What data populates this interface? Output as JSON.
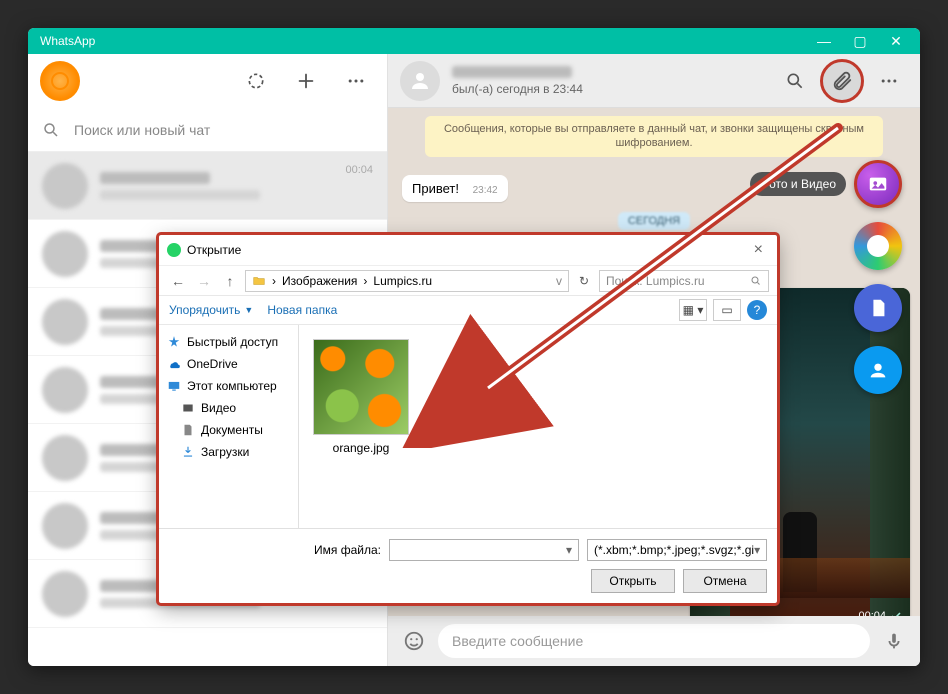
{
  "window": {
    "app_title": "WhatsApp"
  },
  "sidebar": {
    "search_placeholder": "Поиск или новый чат",
    "chats": [
      {
        "time": "00:04"
      },
      {
        "time": ""
      },
      {
        "time": ""
      },
      {
        "time": ""
      },
      {
        "time": ""
      },
      {
        "time": ""
      },
      {
        "time": ""
      }
    ]
  },
  "chat": {
    "status": "был(-а) сегодня в 23:44",
    "encryption_banner": "Сообщения, которые вы отправляете в данный чат, и звонки защищены сквозным шифрованием.",
    "messages": {
      "greeting_text": "Привет!",
      "greeting_time": "23:42"
    },
    "day_label": "СЕГОДНЯ",
    "video_duration": "00:04",
    "input_placeholder": "Введите сообщение"
  },
  "attach_menu": {
    "photo_video_tip": "Фото и Видео"
  },
  "file_dialog": {
    "title": "Открытие",
    "breadcrumb_root": "Изображения",
    "breadcrumb_leaf": "Lumpics.ru",
    "search_placeholder": "Поиск: Lumpics.ru",
    "organize": "Упорядочить",
    "new_folder": "Новая папка",
    "tree": {
      "quick": "Быстрый доступ",
      "onedrive": "OneDrive",
      "this_pc": "Этот компьютер",
      "video": "Видео",
      "documents": "Документы",
      "downloads": "Загрузки"
    },
    "file_name": "orange.jpg",
    "filename_label": "Имя файла:",
    "filetype": "(*.xbm;*.bmp;*.jpeg;*.svgz;*.gi",
    "open_btn": "Открыть",
    "cancel_btn": "Отмена"
  }
}
